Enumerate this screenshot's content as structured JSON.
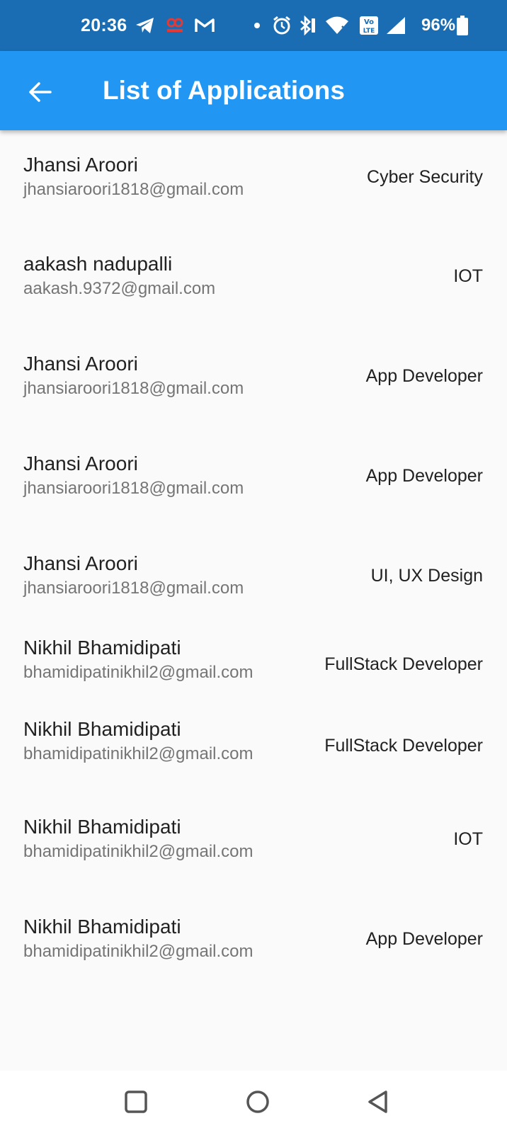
{
  "status_bar": {
    "time": "20:36",
    "battery_percent": "96%",
    "icons": [
      "telegram-icon",
      "hood-icon",
      "gmail-icon",
      "dot-icon",
      "alarm-icon",
      "bluetooth-icon",
      "wifi-icon",
      "volte-icon",
      "signal-icon",
      "battery-icon"
    ]
  },
  "app_bar": {
    "title": "List of Applications",
    "background_color": "#2196f3",
    "back_icon": "arrow-left-icon"
  },
  "applications": [
    {
      "name": "Jhansi Aroori",
      "email": "jhansiaroori1818@gmail.com",
      "role": "Cyber Security"
    },
    {
      "name": "aakash nadupalli",
      "email": "aakash.9372@gmail.com",
      "role": "IOT"
    },
    {
      "name": "Jhansi Aroori",
      "email": "jhansiaroori1818@gmail.com",
      "role": "App Developer"
    },
    {
      "name": "Jhansi Aroori",
      "email": "jhansiaroori1818@gmail.com",
      "role": "App Developer"
    },
    {
      "name": "Jhansi Aroori",
      "email": "jhansiaroori1818@gmail.com",
      "role": "UI, UX Design"
    },
    {
      "name": "Nikhil Bhamidipati",
      "email": "bhamidipatinikhil2@gmail.com",
      "role": "FullStack Developer"
    },
    {
      "name": "Nikhil Bhamidipati",
      "email": "bhamidipatinikhil2@gmail.com",
      "role": "FullStack Developer"
    },
    {
      "name": "Nikhil Bhamidipati",
      "email": "bhamidipatinikhil2@gmail.com",
      "role": "IOT"
    },
    {
      "name": "Nikhil Bhamidipati",
      "email": "bhamidipatinikhil2@gmail.com",
      "role": "App Developer"
    }
  ],
  "nav_bar": {
    "icons": [
      "square-recents-icon",
      "circle-home-icon",
      "triangle-back-icon"
    ]
  }
}
